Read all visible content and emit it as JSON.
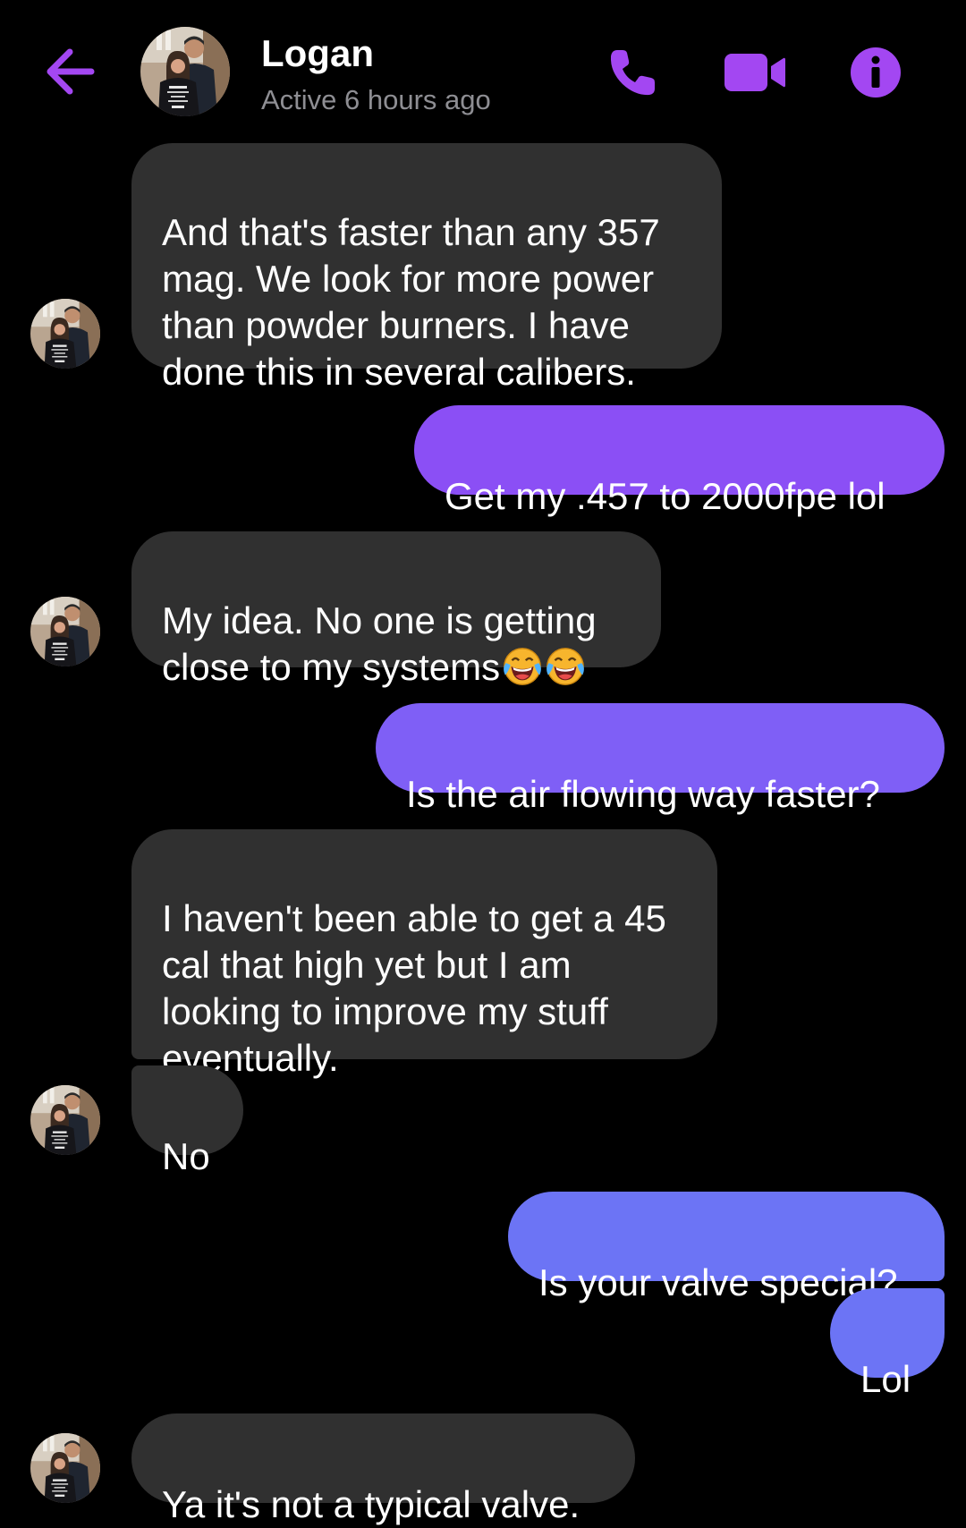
{
  "header": {
    "contact_name": "Logan",
    "status": "Active 6 hours ago",
    "back_icon": "arrow-left-icon",
    "call_icon": "phone-icon",
    "video_icon": "video-camera-icon",
    "info_icon": "info-icon"
  },
  "colors": {
    "accent": "#a347f2",
    "incoming_bubble": "#303030",
    "outgoing_purple": "#8b4ff5",
    "outgoing_blue": "#6c74f5",
    "background": "#000000"
  },
  "messages": [
    {
      "from": "Logan",
      "text": "And that's faster than any 357\nmag. We look for more power\nthan powder burners. I have\ndone this in several calibers."
    },
    {
      "from": "me",
      "text": "Get my .457 to 2000fpe lol"
    },
    {
      "from": "Logan",
      "text": "My idea. No one is getting\nclose to my systems",
      "emoji": [
        "face-with-tears-of-joy",
        "face-with-tears-of-joy"
      ]
    },
    {
      "from": "me",
      "text": "Is the air flowing way faster?"
    },
    {
      "from": "Logan",
      "text": "I haven't been able to get a 45\ncal that high yet but I am\nlooking to improve my stuff\neventually."
    },
    {
      "from": "Logan",
      "text": "No"
    },
    {
      "from": "me",
      "text": "Is your valve special?"
    },
    {
      "from": "me",
      "text": "Lol"
    },
    {
      "from": "Logan",
      "text": "Ya it's not a typical valve."
    }
  ]
}
